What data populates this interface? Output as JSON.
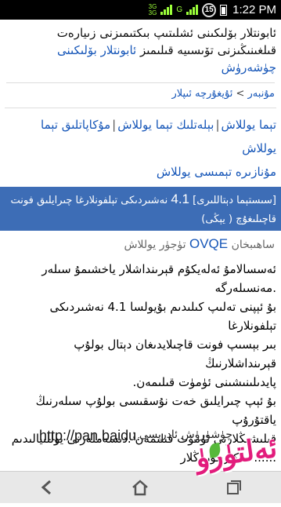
{
  "status_bar": {
    "net_top": "3G",
    "net_bottom": "3G",
    "sim_label": "G",
    "notification_count": "15",
    "time": "1:22 PM",
    "colors": {
      "signal": "#9cff3a"
    }
  },
  "page": {
    "title_plain": "ئابونتلار بۆلىكىنى ئشلىتىپ بىكتىمىزنى زىيارەت قىلغىنىڭىزنى تۆىسىيە قىلىمىز ",
    "title_link": "ئابونتلار بۆلىكىنى چۈشەرۈش",
    "breadcrumb_home": "مۇنبەر",
    "breadcrumb_sep": ">",
    "breadcrumb_current": "ئۇيغۇرچە ئىپلار",
    "tabs": [
      "تېما يوللاش",
      "بېلەتلىك تېما يوللاش",
      "مۇكاپاتلىق تېما يوللاش",
      "مۇنازىرە تېمىسى يوللاش"
    ],
    "tab_separator": "|",
    "banner_tag": "[سىستېما دېتاللىرى]",
    "banner_number": "4.1",
    "banner_text": "نەشىردىكى تېلفونلارغا چىرايلىق فونت",
    "banner_sub": "قاچىلىغۇچ  ( يېڭى)",
    "author_prefix": "ساھىبخان",
    "author_name": "OVQE",
    "author_suffix": "تۈجۈر يوللاش",
    "body_lines": [
      "ئەسسالامۇ ئەلەيكۇم قېرىنداشلار ياخشىمۇ سىلەر .مەنسىلەرگە",
      "بۇ ئېپنى تەلىپ كىلىدىم بۇيولسا 4.1 نەشىردىكى تېلفونلارغا",
      "بىر بېسىپ فونت قاچىلايدىغان دېتال بولۇپ قېرىنداشلارنىڭ",
      "پايدىلىنىشىنى ئۈمۈت قىلىمەن.",
      "بۇ ئېپ چىرايلىق خەت نۇسقىسى بولۇپ سىلەرنىڭ ياقتۇرۇپ",
      "قىلىشىڭلارنى ئۈمۈت قىلىمەن .دىسەملەرنى يوللىيالىدىم",
      "..........كىرچۈرۈڭلار"
    ],
    "download_label": "چۈشۈرۈش ئادرېسى :",
    "download_url": "http://pan.baidu."
  },
  "watermark_logo": "ئەلتۈرۈ",
  "nav": {
    "back": "back-arrow",
    "home": "home-icon",
    "recents": "recent-apps-icon"
  },
  "colors": {
    "link": "#1656b8",
    "banner_bg": "#3d6db6",
    "logo": "#e21c7c"
  }
}
